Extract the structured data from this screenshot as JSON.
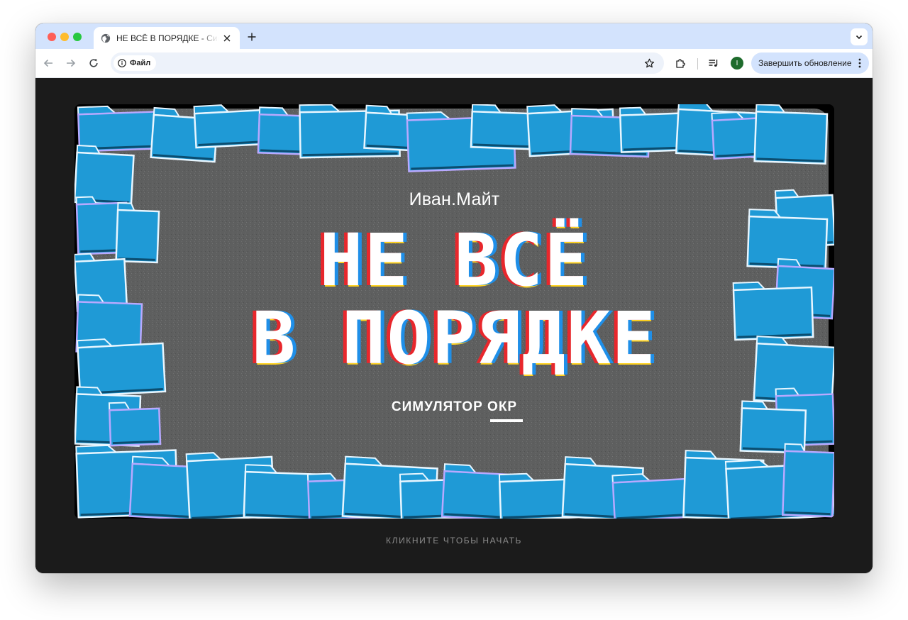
{
  "browser": {
    "tab": {
      "title": "НЕ ВСЁ В ПОРЯДКЕ - Симулятор ОКР"
    },
    "omnibox": {
      "site_label": "Файл"
    },
    "profile": {
      "initial": "I"
    },
    "update_button": {
      "label": "Завершить обновление"
    }
  },
  "page": {
    "brand": "Иван.Майт",
    "title_line_1": "НЕ ВСЁ",
    "title_line_2": "В ПОРЯДКЕ",
    "subtitle": "СИМУЛЯТОР ОКР",
    "start_hint": "КЛИКНИТЕ ЧТОБЫ НАЧАТЬ"
  },
  "colors": {
    "folder": "#1f9ad6",
    "center_panel": "#5e5f5f",
    "glitch_red": "#e8272c",
    "glitch_blue": "#1f8fe8",
    "tabstrip": "#d3e3fd"
  },
  "icons": {
    "favicon": "globe-icon",
    "close": "close-icon",
    "new_tab": "plus-icon",
    "back": "arrow-left-icon",
    "forward": "arrow-right-icon",
    "reload": "reload-icon",
    "info": "info-icon",
    "bookmark": "star-icon",
    "extensions": "puzzle-icon",
    "media": "media-control-icon",
    "menu": "kebab-menu-icon"
  }
}
